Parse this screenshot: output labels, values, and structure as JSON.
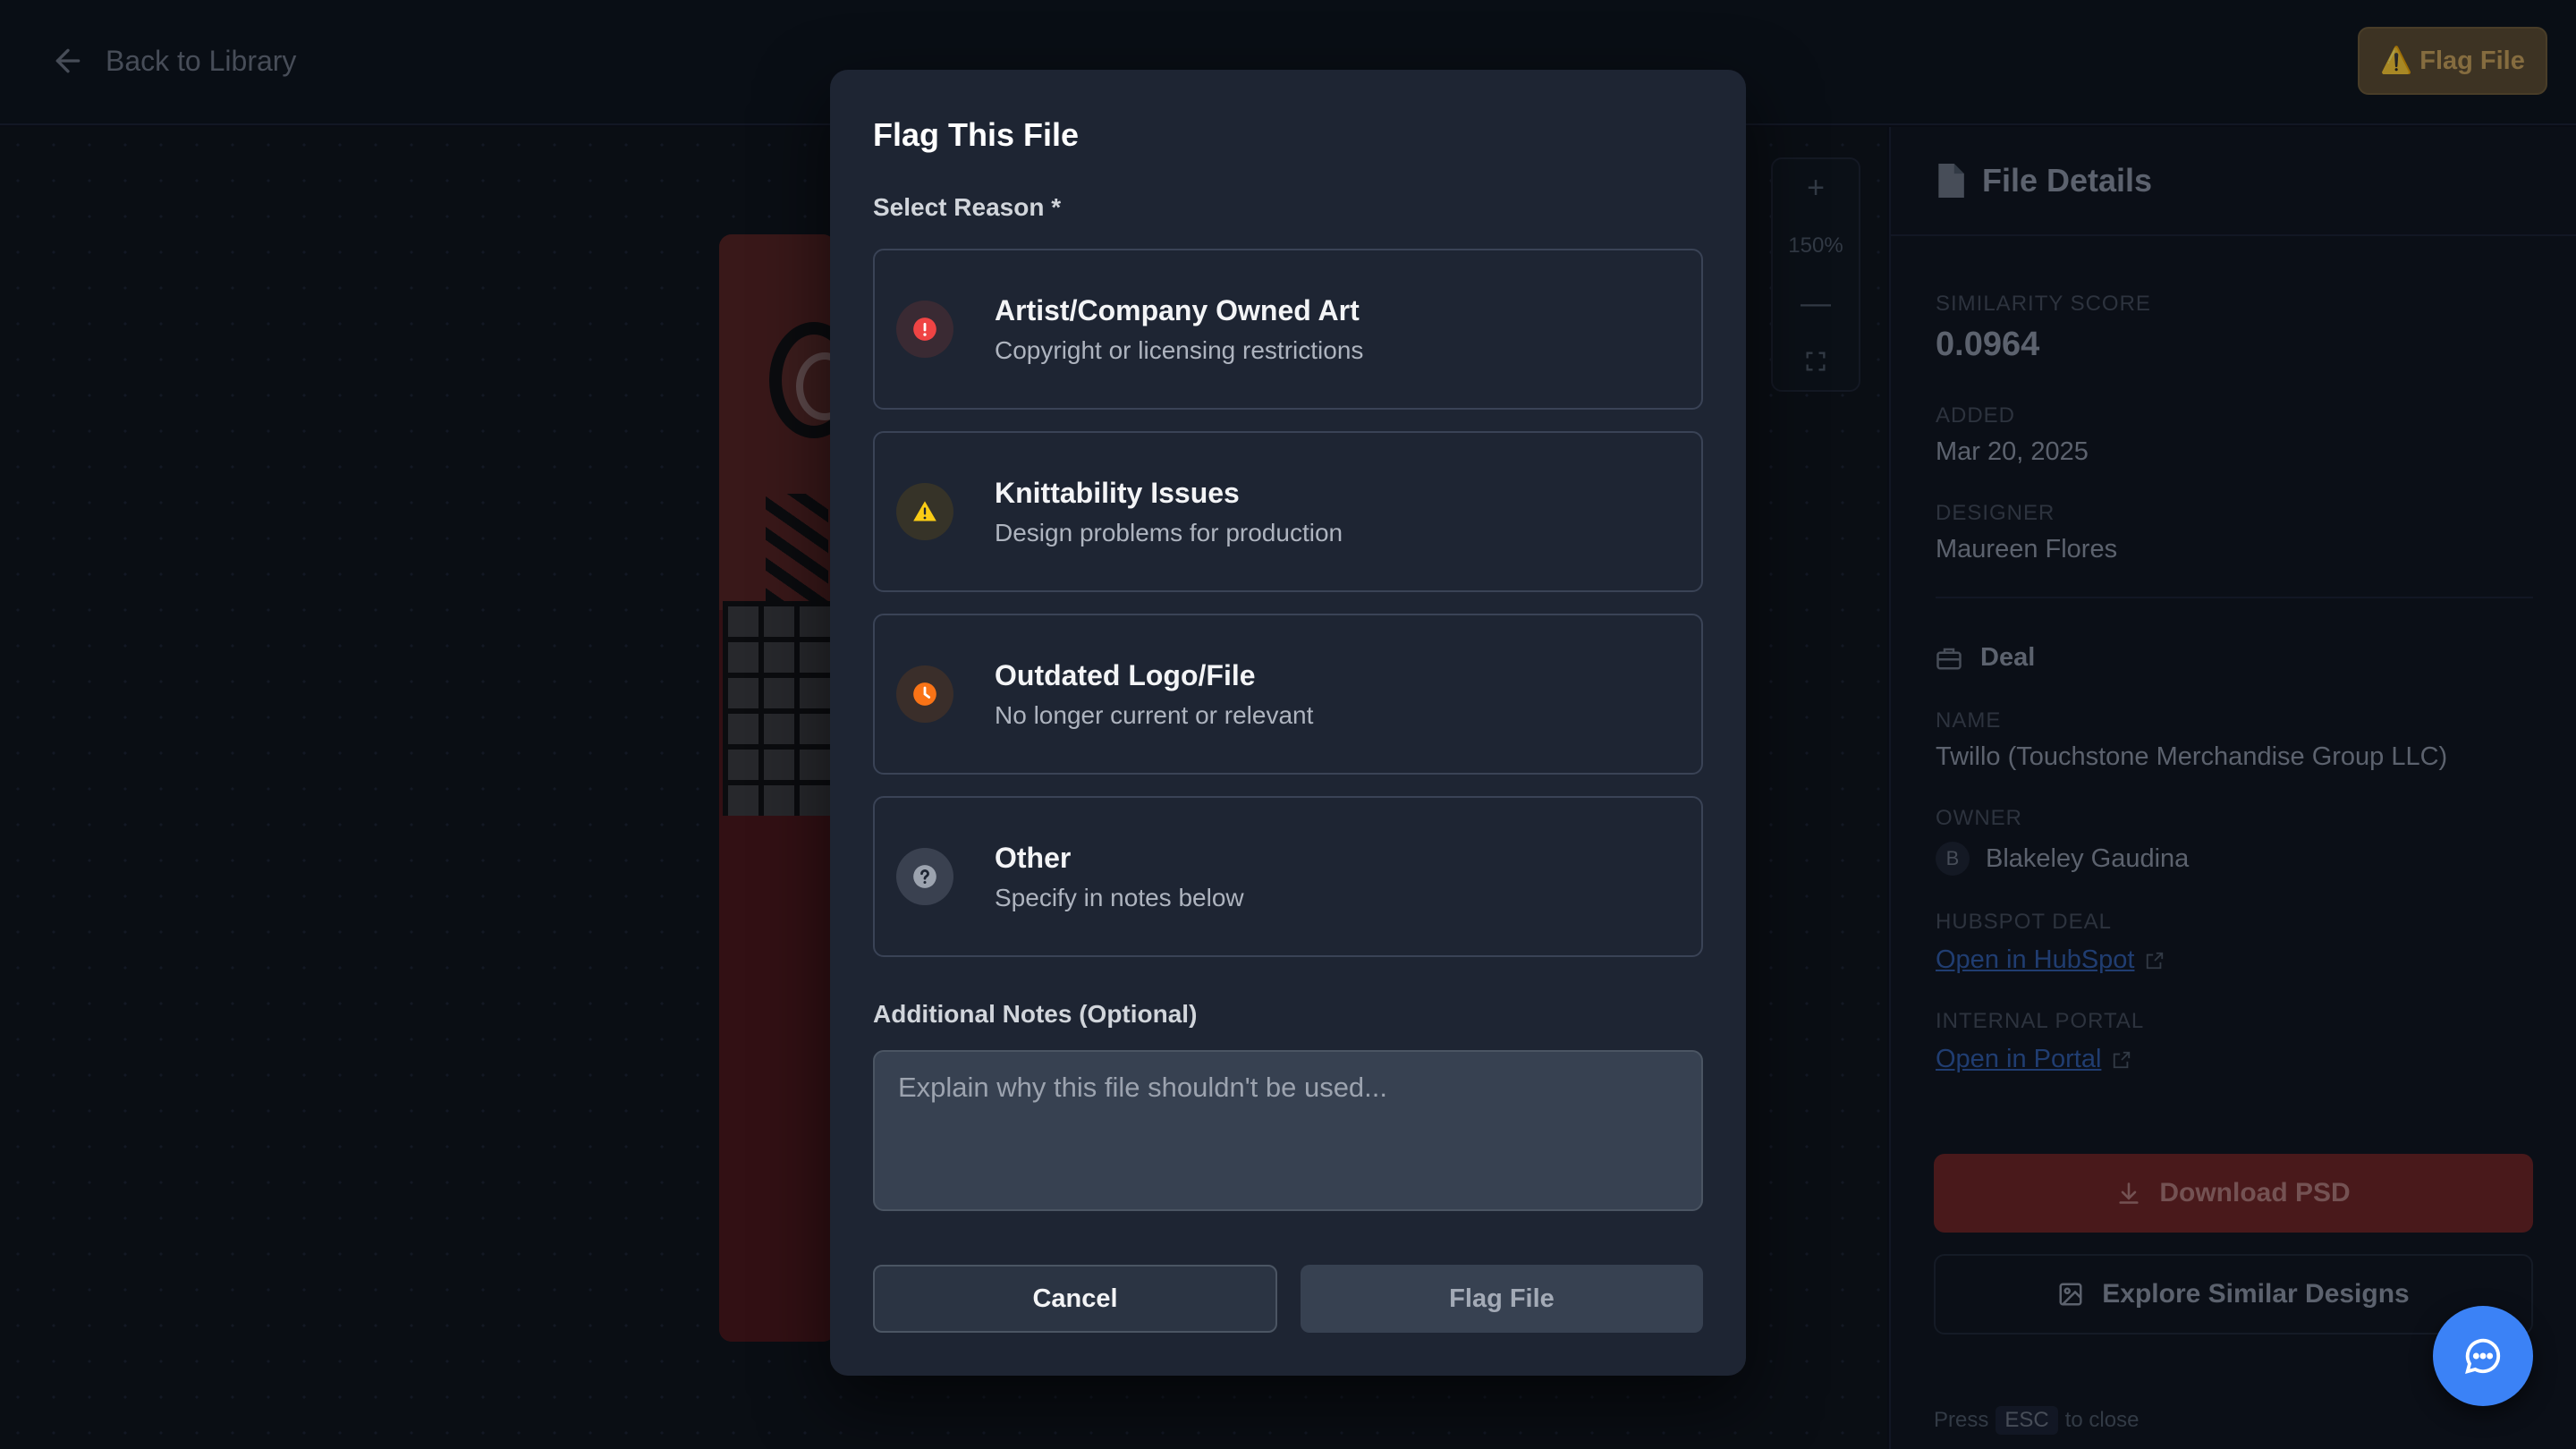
{
  "header": {
    "back_label": "Back to Library",
    "flag_button_label": "Flag File",
    "flag_button_glyph": "⚠️"
  },
  "viewer": {
    "zoom_in": "+",
    "zoom_level": "150%",
    "zoom_out": "—"
  },
  "side_panel": {
    "title": "File Details",
    "similarity_label": "SIMILARITY SCORE",
    "similarity_value": "0.0964",
    "added_label": "ADDED",
    "added_value": "Mar 20, 2025",
    "designer_label": "DESIGNER",
    "designer_value": "Maureen Flores",
    "deal_title": "Deal",
    "name_label": "NAME",
    "name_value": "Twillo (Touchstone Merchandise Group LLC)",
    "owner_label": "OWNER",
    "owner_initial": "B",
    "owner_value": "Blakeley Gaudina",
    "hubspot_label": "HUBSPOT DEAL",
    "hubspot_link": "Open in HubSpot",
    "portal_label": "INTERNAL PORTAL",
    "portal_link": "Open in Portal",
    "download_label": "Download PSD",
    "explore_label": "Explore Similar Designs",
    "esc_prefix": "Press",
    "esc_key": "ESC",
    "esc_suffix": "to close"
  },
  "modal": {
    "title": "Flag This File",
    "reason_label": "Select Reason *",
    "reasons": [
      {
        "title": "Artist/Company Owned Art",
        "desc": "Copyright or licensing restrictions",
        "icon": "alert-circle-icon",
        "color": "#ef4444"
      },
      {
        "title": "Knittability Issues",
        "desc": "Design problems for production",
        "icon": "warning-triangle-icon",
        "color": "#facc15"
      },
      {
        "title": "Outdated Logo/File",
        "desc": "No longer current or relevant",
        "icon": "clock-icon",
        "color": "#f97316"
      },
      {
        "title": "Other",
        "desc": "Specify in notes below",
        "icon": "help-circle-icon",
        "color": "#9ca3af"
      }
    ],
    "notes_label": "Additional Notes (Optional)",
    "notes_placeholder": "Explain why this file shouldn't be used...",
    "cancel_label": "Cancel",
    "flag_label": "Flag File"
  },
  "colors": {
    "accent_blue": "#3b82f6",
    "modal_bg": "#1e2533",
    "danger": "#ef4444"
  }
}
